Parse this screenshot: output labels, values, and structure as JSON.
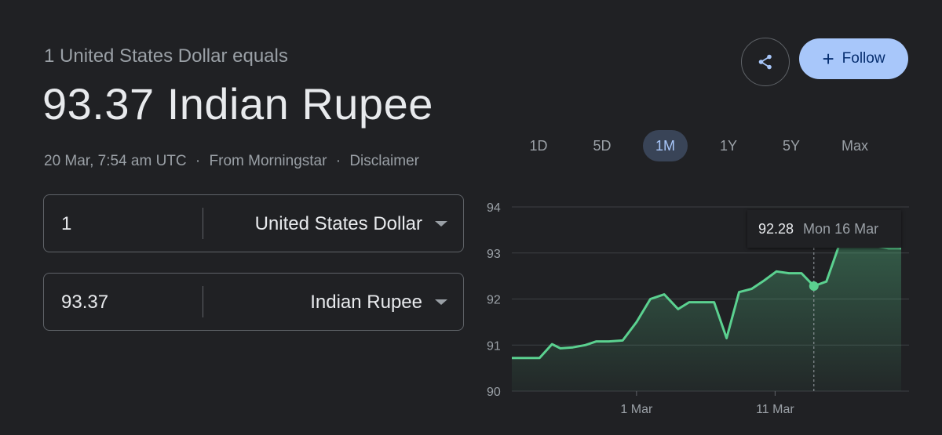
{
  "header": {
    "equals_text": "1 United States Dollar equals",
    "converted_text": "93.37 Indian Rupee",
    "timestamp": "20 Mar, 7:54 am UTC",
    "source": "From Morningstar",
    "disclaimer": "Disclaimer",
    "separator": "·"
  },
  "actions": {
    "share_icon": "share-icon",
    "follow_icon": "+",
    "follow_label": "Follow"
  },
  "converter": {
    "from": {
      "amount": "1",
      "currency": "United States Dollar"
    },
    "to": {
      "amount": "93.37",
      "currency": "Indian Rupee"
    }
  },
  "ranges": [
    "1D",
    "5D",
    "1M",
    "1Y",
    "5Y",
    "Max"
  ],
  "active_range": "1M",
  "tooltip": {
    "value": "92.28",
    "date": "Mon 16 Mar"
  },
  "colors": {
    "line": "#5bd190",
    "accent": "#a8c7fa",
    "background": "#202124"
  },
  "chart_data": {
    "type": "area",
    "ylim": [
      90,
      94
    ],
    "yticks": [
      "90",
      "91",
      "92",
      "93",
      "94"
    ],
    "xticks": [
      {
        "label": "1 Mar",
        "x": 9
      },
      {
        "label": "11 Mar",
        "x": 19
      }
    ],
    "x": [
      0,
      1,
      2,
      2.9,
      3.5,
      4.4,
      5.3,
      6.1,
      7,
      8,
      9,
      10,
      11,
      12,
      12.8,
      13.6,
      14.6,
      15.5,
      16.4,
      17.3,
      18.2,
      19.1,
      20,
      20.9,
      21.8,
      22.7,
      23.6,
      24.5,
      25.4,
      26.3,
      27.2,
      28.1
    ],
    "values": [
      90.72,
      90.72,
      90.72,
      91.02,
      90.93,
      90.95,
      91.0,
      91.08,
      91.08,
      91.1,
      91.5,
      92.0,
      92.1,
      91.78,
      91.93,
      91.93,
      91.93,
      91.15,
      92.15,
      92.22,
      92.4,
      92.6,
      92.56,
      92.56,
      92.28,
      92.38,
      93.15,
      93.15,
      93.15,
      93.15,
      93.1,
      93.1
    ],
    "highlight_index": 24
  }
}
